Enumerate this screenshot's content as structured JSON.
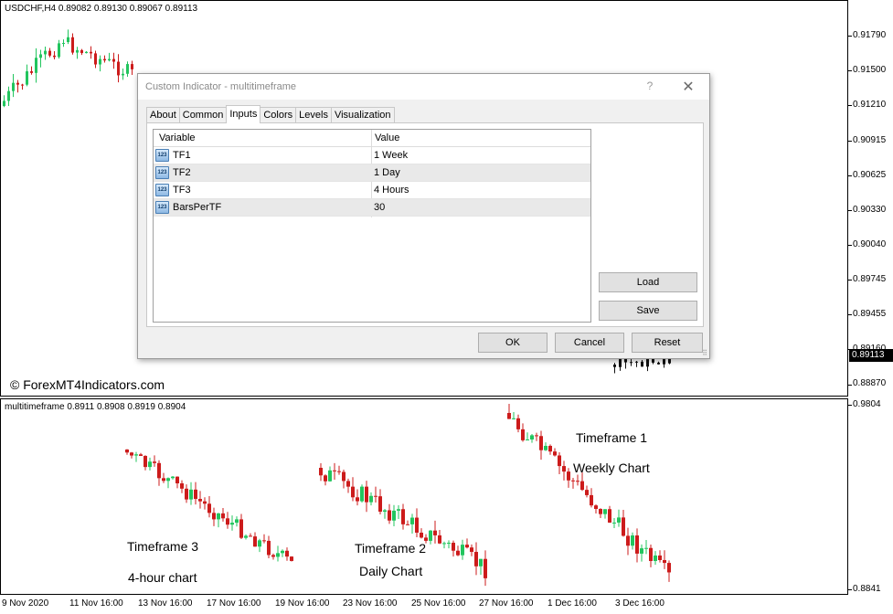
{
  "main_chart": {
    "title": "USDCHF,H4  0.89082 0.89130 0.89067 0.89113",
    "watermark": "© ForexMT4Indicators.com",
    "price_labels": [
      "0.91790",
      "0.91500",
      "0.91210",
      "0.90915",
      "0.90625",
      "0.90330",
      "0.90040",
      "0.89745",
      "0.89455",
      "0.89160",
      "0.88870"
    ],
    "current_price": "0.89113"
  },
  "sub_chart": {
    "title": "multitimeframe 0.8911 0.8908 0.8919 0.8904",
    "axis_top": "0.9804",
    "axis_bottom": "0.8841",
    "annotations": {
      "tf1_line1": "Timeframe 1",
      "tf1_line2": "Weekly Chart",
      "tf2_line1": "Timeframe 2",
      "tf2_line2": "Daily Chart",
      "tf3_line1": "Timeframe 3",
      "tf3_line2": "4-hour chart"
    }
  },
  "time_axis": [
    "9 Nov 2020",
    "11 Nov 16:00",
    "13 Nov 16:00",
    "17 Nov 16:00",
    "19 Nov 16:00",
    "23 Nov 16:00",
    "25 Nov 16:00",
    "27 Nov 16:00",
    "1 Dec 16:00",
    "3 Dec 16:00"
  ],
  "dialog": {
    "title": "Custom Indicator - multitimeframe",
    "help_glyph": "?",
    "close_glyph": "✕",
    "tabs": [
      "About",
      "Common",
      "Inputs",
      "Colors",
      "Levels",
      "Visualization"
    ],
    "active_tab": "Inputs",
    "columns": [
      "Variable",
      "Value"
    ],
    "icon_text": "123",
    "rows": [
      {
        "name": "TF1",
        "value": "1 Week"
      },
      {
        "name": "TF2",
        "value": "1 Day"
      },
      {
        "name": "TF3",
        "value": "4 Hours"
      },
      {
        "name": "BarsPerTF",
        "value": "30"
      }
    ],
    "buttons": {
      "load": "Load",
      "save": "Save",
      "ok": "OK",
      "cancel": "Cancel",
      "reset": "Reset"
    }
  },
  "colors": {
    "bull": "#22c55e",
    "bear": "#cc1b1b",
    "dark": "#111111"
  }
}
